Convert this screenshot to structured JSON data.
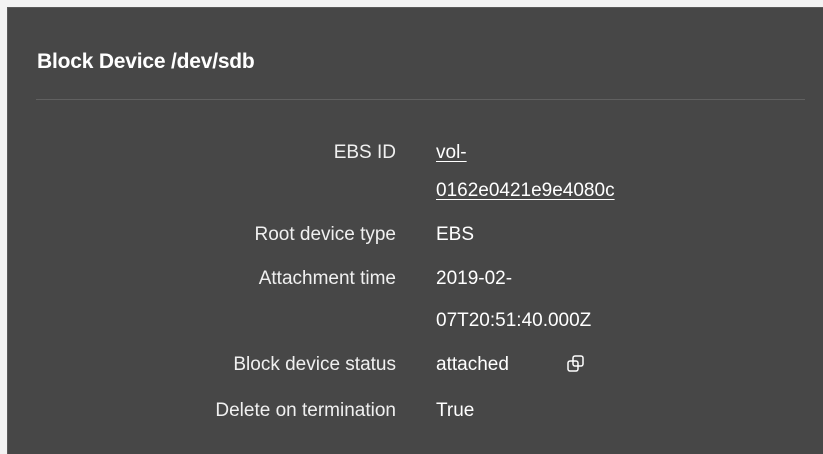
{
  "panel": {
    "title": "Block Device /dev/sdb"
  },
  "details": {
    "ebs_id": {
      "label": "EBS ID",
      "value_line1": "vol-",
      "value_line2": "0162e0421e9e4080c"
    },
    "root_device_type": {
      "label": "Root device type",
      "value": "EBS"
    },
    "attachment_time": {
      "label": "Attachment time",
      "value_line1": "2019-02-",
      "value_line2": "07T20:51:40.000Z"
    },
    "block_device_status": {
      "label": "Block device status",
      "value": "attached",
      "icon": "copy-icon"
    },
    "delete_on_termination": {
      "label": "Delete on termination",
      "value": "True"
    }
  },
  "colors": {
    "panel_bg": "#474747",
    "text": "#ffffff",
    "divider": "#606060"
  }
}
